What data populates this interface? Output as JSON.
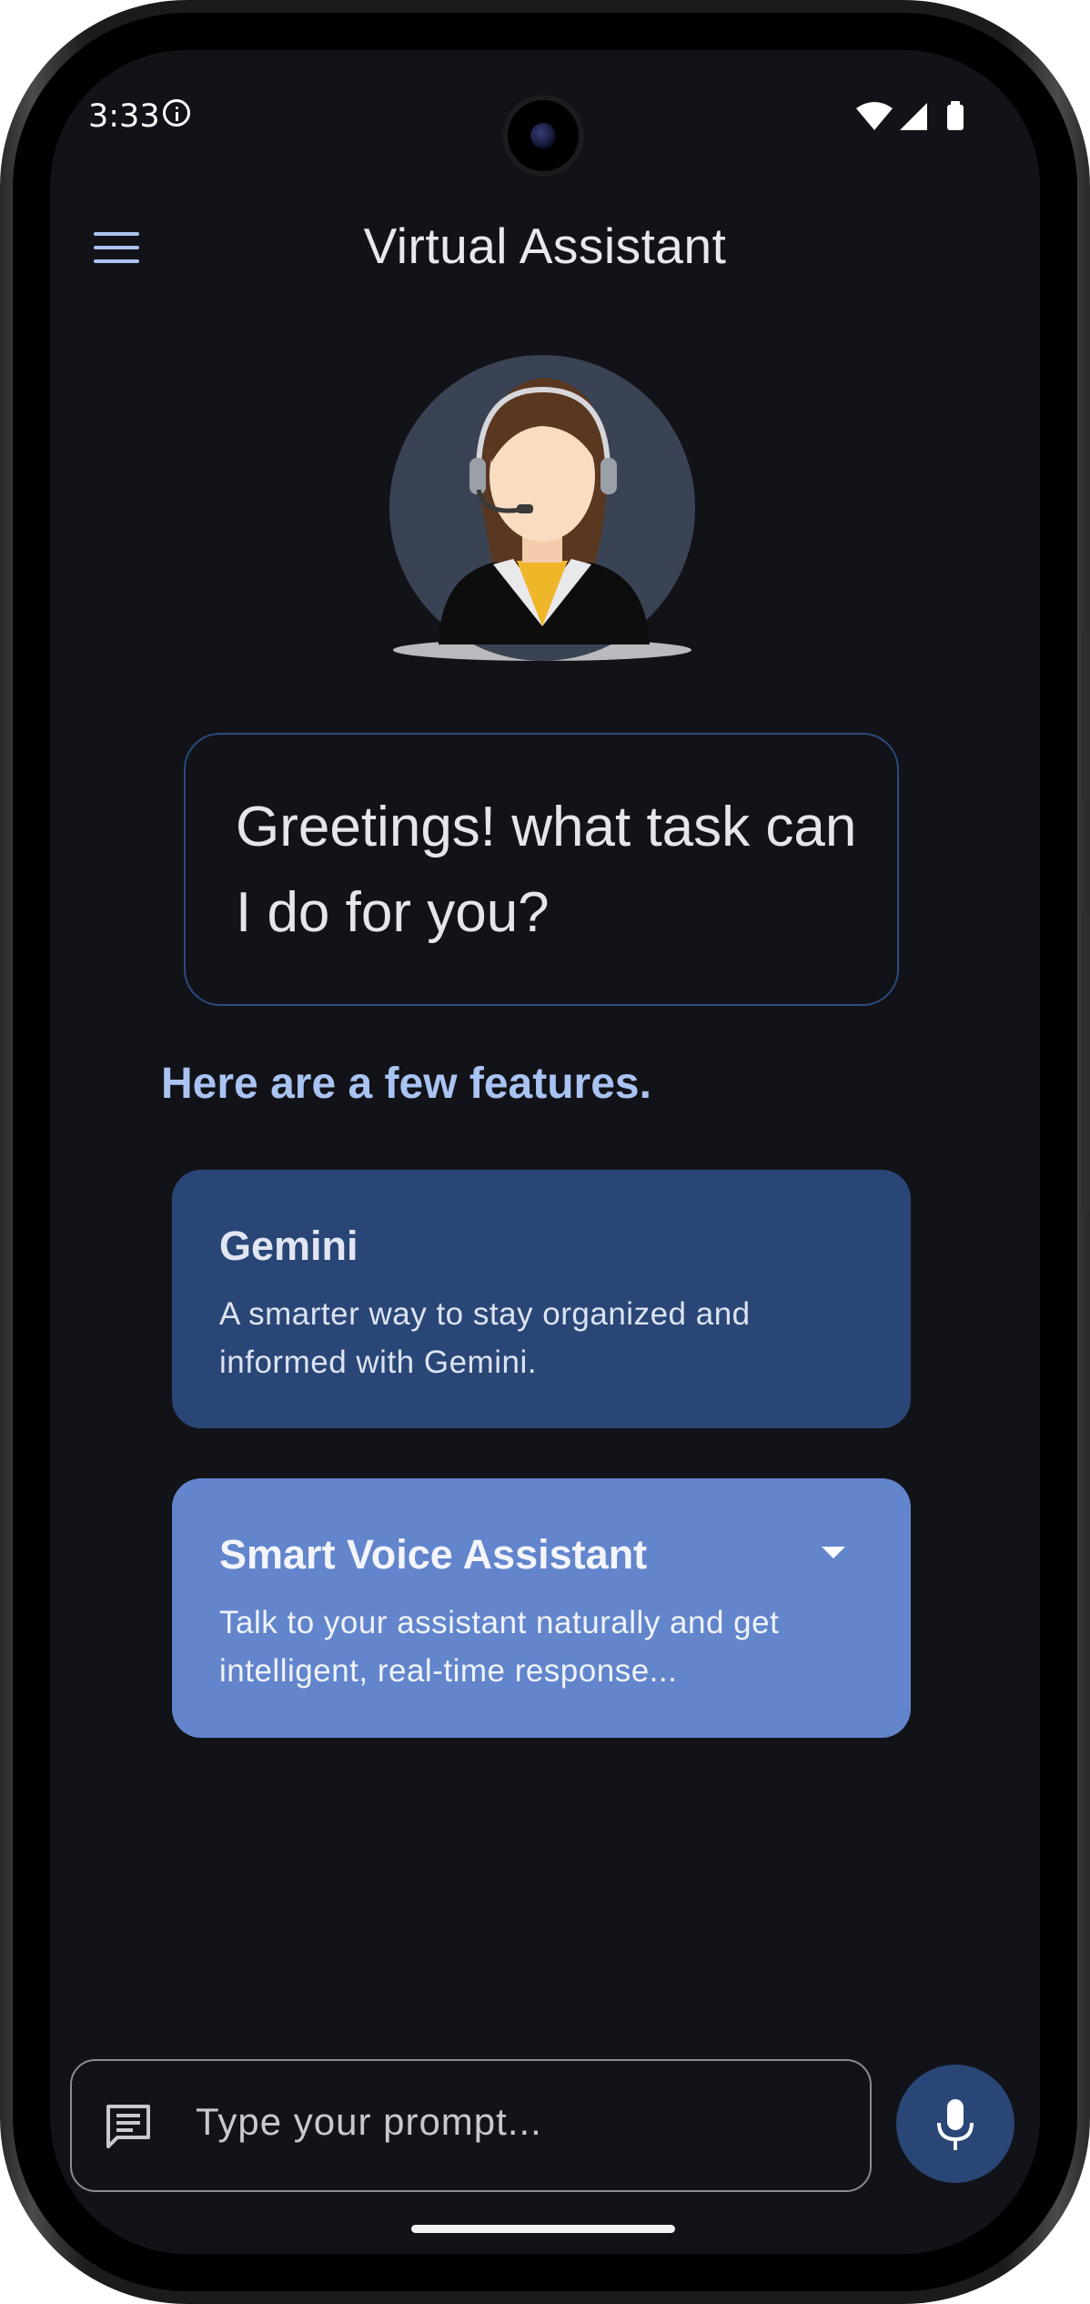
{
  "status_bar": {
    "time": "3:33",
    "icons": [
      "info-icon",
      "wifi-icon",
      "cellular-signal-icon",
      "battery-icon"
    ]
  },
  "app_bar": {
    "title": "Virtual Assistant",
    "menu_icon": "menu-icon"
  },
  "assistant": {
    "avatar": "assistant-avatar",
    "greeting": "Greetings! what task can I do for you?"
  },
  "features": {
    "heading": "Here are a few features.",
    "cards": [
      {
        "title": "Gemini",
        "description": "A smarter way to stay organized and informed with Gemini.",
        "expanded": false
      },
      {
        "title": "Smart Voice Assistant",
        "description": "Talk to your assistant naturally and get intelligent, real-time response...",
        "expand_icon": "chevron-down-icon"
      }
    ]
  },
  "input": {
    "placeholder": "Type your prompt...",
    "leading_icon": "chat-message-icon",
    "mic_icon": "microphone-icon"
  },
  "colors": {
    "background": "#121318",
    "accent": "#a9c3f2",
    "card_primary": "#294676",
    "card_secondary": "#6285cc"
  }
}
